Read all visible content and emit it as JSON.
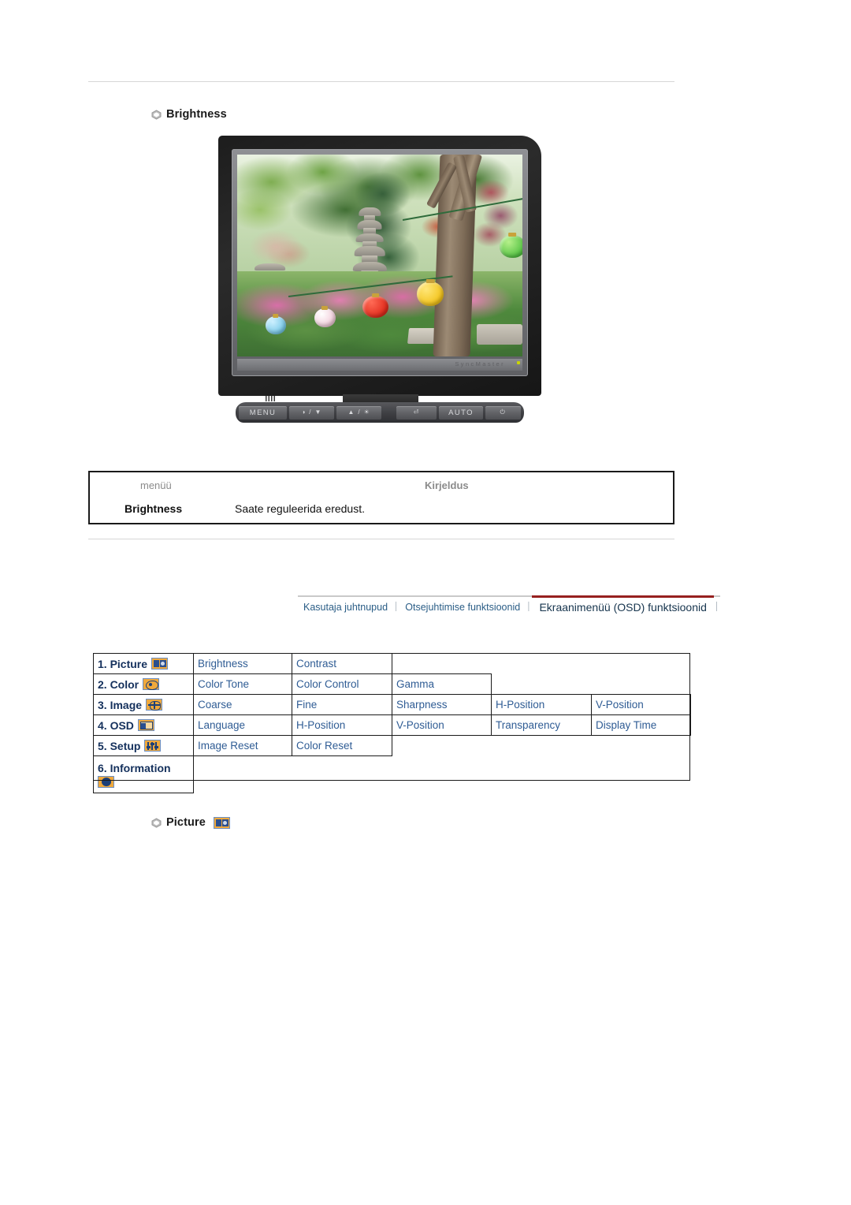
{
  "page": {
    "heading_brightness": "Brightness",
    "heading_picture": "Picture"
  },
  "monitor": {
    "bezel_brand": "SyncMaster",
    "controls": [
      {
        "label": "MENU",
        "name": "menu-button"
      },
      {
        "label": "◑ / ▼",
        "name": "contrast-down-button"
      },
      {
        "label": "▲ / ☀",
        "name": "brightness-up-button"
      },
      {
        "label": "⏎",
        "name": "enter-button"
      },
      {
        "label": "AUTO",
        "name": "auto-button"
      },
      {
        "label": "⏻",
        "name": "power-button"
      }
    ]
  },
  "description_table": {
    "header_menu": "menüü",
    "header_description": "Kirjeldus",
    "rows": [
      {
        "menu": "Brightness",
        "description": "Saate reguleerida eredust."
      }
    ]
  },
  "tabs": {
    "separator": "│",
    "items": [
      {
        "label": "Kasutaja juhtnupud",
        "active": false
      },
      {
        "label": "Otsejuhtimise funktsioonid",
        "active": false
      },
      {
        "label": "Ekraanimenüü (OSD) funktsioonid",
        "active": true
      }
    ]
  },
  "osd_menu": {
    "rows": [
      {
        "category": "1. Picture",
        "icon": "picture-icon",
        "items": [
          "Brightness",
          "Contrast"
        ]
      },
      {
        "category": "2. Color",
        "icon": "color-icon",
        "items": [
          "Color Tone",
          "Color Control",
          "Gamma"
        ]
      },
      {
        "category": "3. Image",
        "icon": "image-icon",
        "items": [
          "Coarse",
          "Fine",
          "Sharpness",
          "H-Position",
          "V-Position"
        ]
      },
      {
        "category": "4. OSD",
        "icon": "osd-icon",
        "items": [
          "Language",
          "H-Position",
          "V-Position",
          "Transparency",
          "Display Time"
        ]
      },
      {
        "category": "5. Setup",
        "icon": "setup-icon",
        "items": [
          "Image Reset",
          "Color Reset"
        ]
      },
      {
        "category": "6. Information",
        "icon": "information-icon",
        "items": []
      }
    ]
  },
  "colors": {
    "accent_red": "#96201f",
    "link_blue": "#2f5c94",
    "category_blue": "#14305c",
    "icon_orange": "#f0a93c",
    "rule_gray": "#d6d6d6"
  }
}
